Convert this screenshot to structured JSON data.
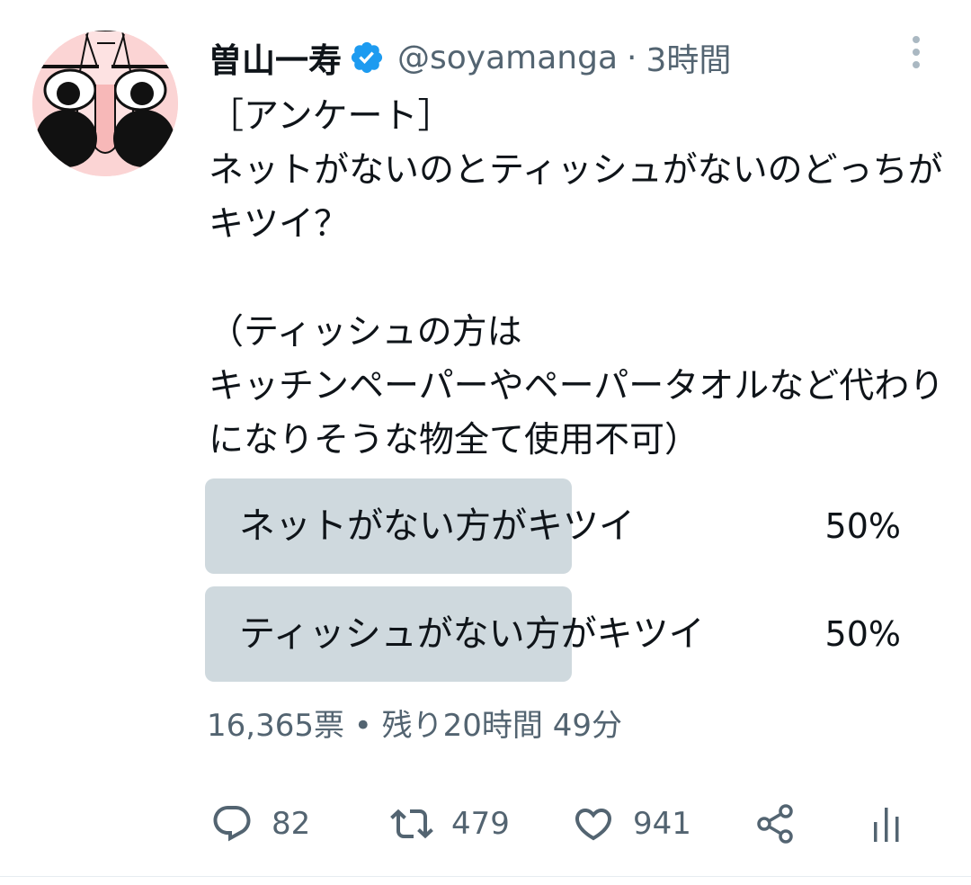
{
  "author": {
    "display_name": "曽山一寿",
    "handle": "@soyamanga",
    "separator": "·",
    "time": "3時間"
  },
  "tweet": {
    "text": "［アンケート］\nネットがないのとティッシュがないのどっちがキツイ？\n\n（ティッシュの方は\nキッチンペーパーやペーパータオルなど代わりになりそうな物全て使用不可）"
  },
  "poll": {
    "options": [
      {
        "label": "ネットがない方がキツイ",
        "percent": "50%",
        "fill_fraction": 0.5
      },
      {
        "label": "ティッシュがない方がキツイ",
        "percent": "50%",
        "fill_fraction": 0.5
      }
    ],
    "meta": "16,365票 • 残り20時間 49分"
  },
  "actions": {
    "reply_count": "82",
    "retweet_count": "479",
    "like_count": "941"
  },
  "icons": {
    "verified": "verified-badge-icon",
    "more": "more-vertical-icon",
    "reply": "reply-icon",
    "retweet": "retweet-icon",
    "like": "heart-icon",
    "share": "share-icon",
    "stats": "analytics-icon"
  },
  "colors": {
    "text_primary": "#0f1419",
    "text_secondary": "#536471",
    "poll_fill": "#cfd9de",
    "verified_blue": "#1d9bf0"
  }
}
